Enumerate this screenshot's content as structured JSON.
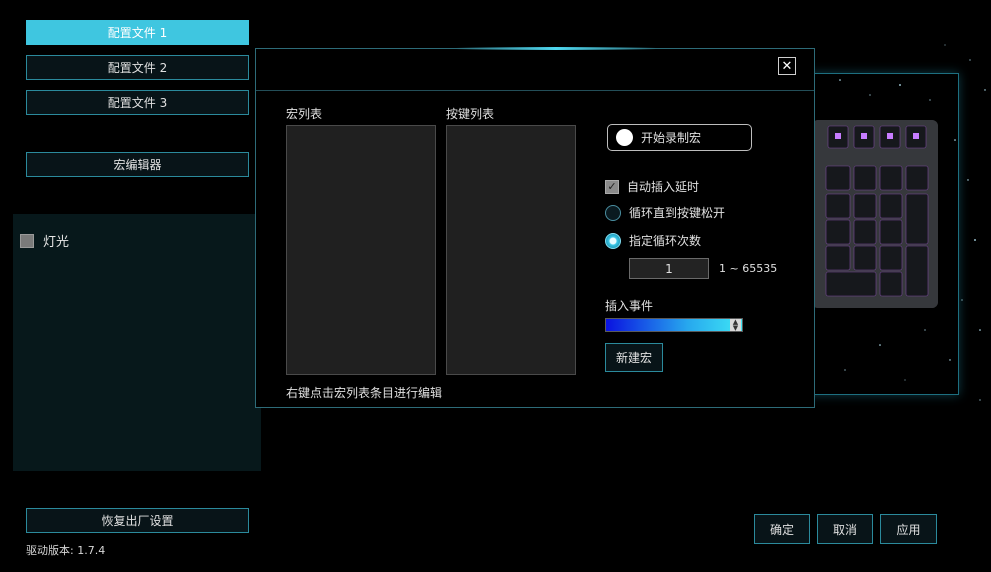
{
  "sidebar": {
    "profiles": [
      "配置文件 1",
      "配置文件 2",
      "配置文件 3"
    ],
    "macro_editor": "宏编辑器",
    "light_label": "灯光",
    "reset": "恢复出厂设置",
    "version": "驱动版本:  1.7.4"
  },
  "footer": {
    "ok": "确定",
    "cancel": "取消",
    "apply": "应用"
  },
  "dialog": {
    "close": "✕",
    "macro_list_label": "宏列表",
    "key_list_label": "按键列表",
    "hint": "右键点击宏列表条目进行编辑",
    "record_label": "开始录制宏",
    "auto_delay": "自动插入延时",
    "loop_until_release": "循环直到按键松开",
    "loop_count": "指定循环次数",
    "loop_value": "1",
    "loop_range": "1 ~ 65535",
    "insert_event_label": "插入事件",
    "new_macro": "新建宏"
  },
  "colors": {
    "accent": "#3fc6e0",
    "border": "#2b8a9c"
  }
}
